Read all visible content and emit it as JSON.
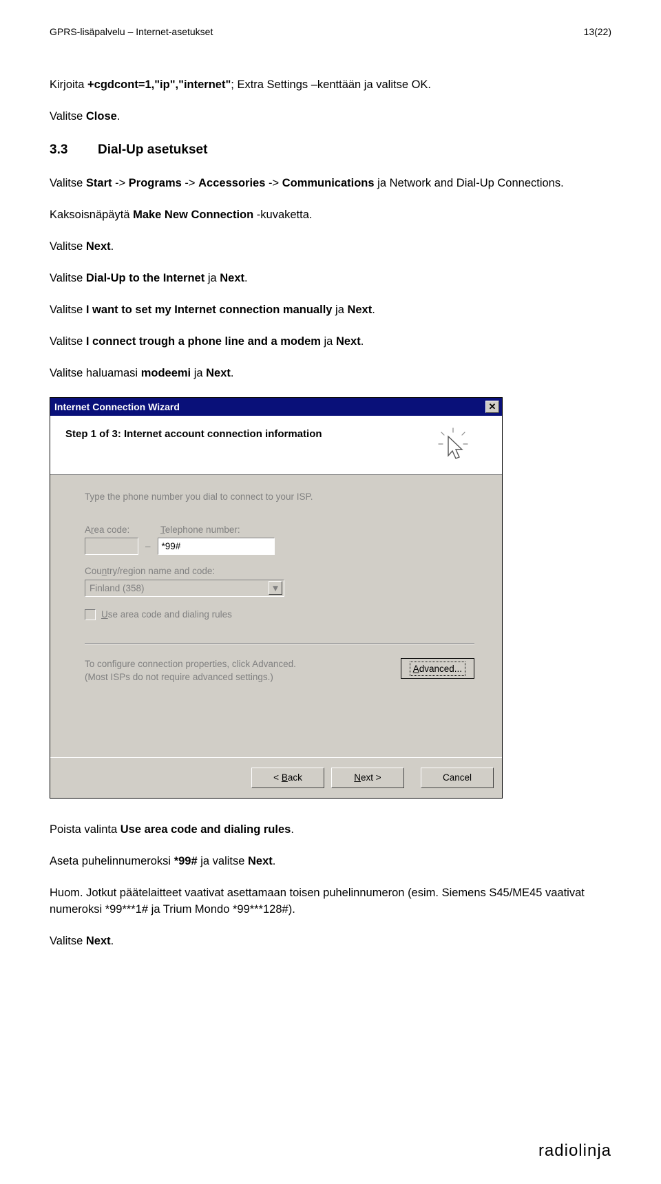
{
  "header": {
    "left": "GPRS-lisäpalvelu – Internet-asetukset",
    "right": "13(22)"
  },
  "body": {
    "p1a": "Kirjoita ",
    "p1b": "+cgdcont=1,\"ip\",\"internet\"",
    "p1c": "; Extra Settings –kenttään ja valitse OK.",
    "p2a": "Valitse ",
    "p2b": "Close",
    "p2c": ".",
    "h3num": "3.3",
    "h3text": "Dial-Up asetukset",
    "p3a": "Valitse ",
    "p3b": "Start",
    "p3c": " -> ",
    "p3d": "Programs",
    "p3e": " -> ",
    "p3f": "Accessories",
    "p3g": " -> ",
    "p3h": "Communications",
    "p3i": " ja Network and Dial-Up Connections.",
    "p4a": "Kaksoisnäpäytä ",
    "p4b": "Make New Connection",
    "p4c": " -kuvaketta.",
    "p5a": "Valitse ",
    "p5b": "Next",
    "p5c": ".",
    "p6a": "Valitse ",
    "p6b": "Dial-Up to the Internet",
    "p6c": " ja ",
    "p6d": "Next",
    "p6e": ".",
    "p7a": "Valitse ",
    "p7b": "I want to set my Internet connection manually",
    "p7c": " ja ",
    "p7d": "Next",
    "p7e": ".",
    "p8a": "Valitse ",
    "p8b": "I connect trough a phone line and a modem",
    "p8c": " ja ",
    "p8d": "Next",
    "p8e": ".",
    "p9a": "Valitse haluamasi ",
    "p9b": "modeemi",
    "p9c": " ja ",
    "p9d": "Next",
    "p9e": ".",
    "p10a": "Poista valinta ",
    "p10b": "Use area code and dialing rules",
    "p10c": ".",
    "p11a": "Aseta puhelinnumeroksi ",
    "p11b": "*99#",
    "p11c": " ja valitse ",
    "p11d": "Next",
    "p11e": ".",
    "p12": "Huom. Jotkut päätelaitteet vaativat asettamaan toisen puhelinnumeron (esim. Siemens S45/ME45 vaativat numeroksi *99***1# ja Trium Mondo *99***128#).",
    "p13a": "Valitse ",
    "p13b": "Next",
    "p13c": "."
  },
  "wizard": {
    "title": "Internet Connection Wizard",
    "banner": "Step 1 of 3: Internet account connection information",
    "instruction": "Type the phone number you dial to connect to your ISP.",
    "area_label_pre": "A",
    "area_label_u": "r",
    "area_label_post": "ea code:",
    "tel_label_u": "T",
    "tel_label_post": "elephone number:",
    "tel_value": "*99#",
    "country_label_pre": "Cou",
    "country_label_u": "n",
    "country_label_post": "try/region name and code:",
    "country_value": "Finland (358)",
    "usearea_u": "U",
    "usearea_post": "se area code and dialing rules",
    "adv1": "To configure connection properties, click Advanced.",
    "adv2": "(Most ISPs do not require advanced settings.)",
    "advanced_btn_u": "A",
    "advanced_btn_post": "dvanced...",
    "back_lt": "<",
    "back_u": "B",
    "back_post": "ack",
    "next_pre": "",
    "next_u": "N",
    "next_post": "ext >",
    "cancel": "Cancel",
    "close_x": "✕"
  },
  "footer": {
    "logo": "radiolinja"
  }
}
